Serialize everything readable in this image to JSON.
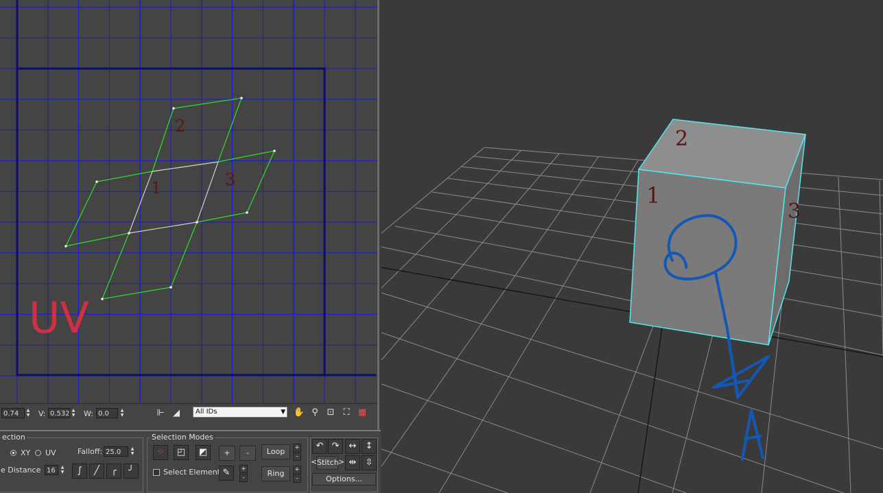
{
  "colors": {
    "uv_grid": "#1a1acc",
    "uv_border": "#0c0c6a",
    "uv_edges": "#2fe02f",
    "selection": "#55e6f0",
    "annotation_blue": "#1458b4",
    "annotation_red": "#d03044",
    "annotation_dark": "#5a1616"
  },
  "annotations": {
    "uv_label": "UV",
    "face_1": "1",
    "face_2": "2",
    "face_3": "3",
    "viewport_face_1": "1",
    "viewport_face_2": "2",
    "viewport_face_3": "3",
    "letter_a": "A"
  },
  "uv_toolbar": {
    "u_value": "0.74",
    "v_label": "V:",
    "v_value": "0.532",
    "w_label": "W:",
    "w_value": "0.0",
    "id_filter": "All IDs",
    "icons": [
      "lock-icon",
      "pick-icon",
      "pan-hand-icon",
      "zoom-icon",
      "zoom-region-icon",
      "zoom-extents-icon",
      "checker-toggle-icon"
    ]
  },
  "soft_selection": {
    "title": "ection",
    "xy_label": "XY",
    "uv_label": "UV",
    "falloff_label": "Falloff:",
    "falloff_value": "25.0",
    "distance_label": "e Distance",
    "distance_value": "16"
  },
  "selection_modes": {
    "title": "Selection Modes",
    "plus": "+",
    "minus": "-",
    "loop_label": "Loop",
    "ring_label": "Ring",
    "select_element_label": "Select Element"
  },
  "edit_tools": {
    "stitch_label": "Stitch",
    "stitch_left": "<",
    "stitch_right": ">",
    "options_label": "Options..."
  }
}
